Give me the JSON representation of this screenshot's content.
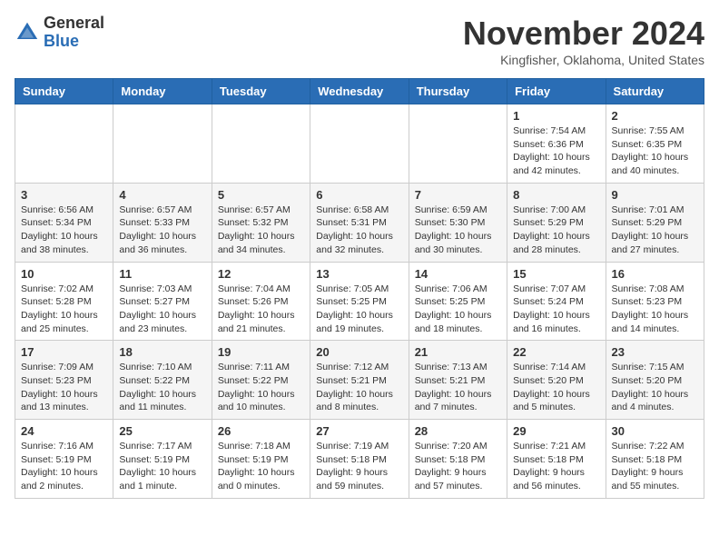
{
  "header": {
    "logo_general": "General",
    "logo_blue": "Blue",
    "month_title": "November 2024",
    "location": "Kingfisher, Oklahoma, United States"
  },
  "weekdays": [
    "Sunday",
    "Monday",
    "Tuesday",
    "Wednesday",
    "Thursday",
    "Friday",
    "Saturday"
  ],
  "weeks": [
    [
      {
        "day": "",
        "info": ""
      },
      {
        "day": "",
        "info": ""
      },
      {
        "day": "",
        "info": ""
      },
      {
        "day": "",
        "info": ""
      },
      {
        "day": "",
        "info": ""
      },
      {
        "day": "1",
        "info": "Sunrise: 7:54 AM\nSunset: 6:36 PM\nDaylight: 10 hours\nand 42 minutes."
      },
      {
        "day": "2",
        "info": "Sunrise: 7:55 AM\nSunset: 6:35 PM\nDaylight: 10 hours\nand 40 minutes."
      }
    ],
    [
      {
        "day": "3",
        "info": "Sunrise: 6:56 AM\nSunset: 5:34 PM\nDaylight: 10 hours\nand 38 minutes."
      },
      {
        "day": "4",
        "info": "Sunrise: 6:57 AM\nSunset: 5:33 PM\nDaylight: 10 hours\nand 36 minutes."
      },
      {
        "day": "5",
        "info": "Sunrise: 6:57 AM\nSunset: 5:32 PM\nDaylight: 10 hours\nand 34 minutes."
      },
      {
        "day": "6",
        "info": "Sunrise: 6:58 AM\nSunset: 5:31 PM\nDaylight: 10 hours\nand 32 minutes."
      },
      {
        "day": "7",
        "info": "Sunrise: 6:59 AM\nSunset: 5:30 PM\nDaylight: 10 hours\nand 30 minutes."
      },
      {
        "day": "8",
        "info": "Sunrise: 7:00 AM\nSunset: 5:29 PM\nDaylight: 10 hours\nand 28 minutes."
      },
      {
        "day": "9",
        "info": "Sunrise: 7:01 AM\nSunset: 5:29 PM\nDaylight: 10 hours\nand 27 minutes."
      }
    ],
    [
      {
        "day": "10",
        "info": "Sunrise: 7:02 AM\nSunset: 5:28 PM\nDaylight: 10 hours\nand 25 minutes."
      },
      {
        "day": "11",
        "info": "Sunrise: 7:03 AM\nSunset: 5:27 PM\nDaylight: 10 hours\nand 23 minutes."
      },
      {
        "day": "12",
        "info": "Sunrise: 7:04 AM\nSunset: 5:26 PM\nDaylight: 10 hours\nand 21 minutes."
      },
      {
        "day": "13",
        "info": "Sunrise: 7:05 AM\nSunset: 5:25 PM\nDaylight: 10 hours\nand 19 minutes."
      },
      {
        "day": "14",
        "info": "Sunrise: 7:06 AM\nSunset: 5:25 PM\nDaylight: 10 hours\nand 18 minutes."
      },
      {
        "day": "15",
        "info": "Sunrise: 7:07 AM\nSunset: 5:24 PM\nDaylight: 10 hours\nand 16 minutes."
      },
      {
        "day": "16",
        "info": "Sunrise: 7:08 AM\nSunset: 5:23 PM\nDaylight: 10 hours\nand 14 minutes."
      }
    ],
    [
      {
        "day": "17",
        "info": "Sunrise: 7:09 AM\nSunset: 5:23 PM\nDaylight: 10 hours\nand 13 minutes."
      },
      {
        "day": "18",
        "info": "Sunrise: 7:10 AM\nSunset: 5:22 PM\nDaylight: 10 hours\nand 11 minutes."
      },
      {
        "day": "19",
        "info": "Sunrise: 7:11 AM\nSunset: 5:22 PM\nDaylight: 10 hours\nand 10 minutes."
      },
      {
        "day": "20",
        "info": "Sunrise: 7:12 AM\nSunset: 5:21 PM\nDaylight: 10 hours\nand 8 minutes."
      },
      {
        "day": "21",
        "info": "Sunrise: 7:13 AM\nSunset: 5:21 PM\nDaylight: 10 hours\nand 7 minutes."
      },
      {
        "day": "22",
        "info": "Sunrise: 7:14 AM\nSunset: 5:20 PM\nDaylight: 10 hours\nand 5 minutes."
      },
      {
        "day": "23",
        "info": "Sunrise: 7:15 AM\nSunset: 5:20 PM\nDaylight: 10 hours\nand 4 minutes."
      }
    ],
    [
      {
        "day": "24",
        "info": "Sunrise: 7:16 AM\nSunset: 5:19 PM\nDaylight: 10 hours\nand 2 minutes."
      },
      {
        "day": "25",
        "info": "Sunrise: 7:17 AM\nSunset: 5:19 PM\nDaylight: 10 hours\nand 1 minute."
      },
      {
        "day": "26",
        "info": "Sunrise: 7:18 AM\nSunset: 5:19 PM\nDaylight: 10 hours\nand 0 minutes."
      },
      {
        "day": "27",
        "info": "Sunrise: 7:19 AM\nSunset: 5:18 PM\nDaylight: 9 hours\nand 59 minutes."
      },
      {
        "day": "28",
        "info": "Sunrise: 7:20 AM\nSunset: 5:18 PM\nDaylight: 9 hours\nand 57 minutes."
      },
      {
        "day": "29",
        "info": "Sunrise: 7:21 AM\nSunset: 5:18 PM\nDaylight: 9 hours\nand 56 minutes."
      },
      {
        "day": "30",
        "info": "Sunrise: 7:22 AM\nSunset: 5:18 PM\nDaylight: 9 hours\nand 55 minutes."
      }
    ]
  ]
}
